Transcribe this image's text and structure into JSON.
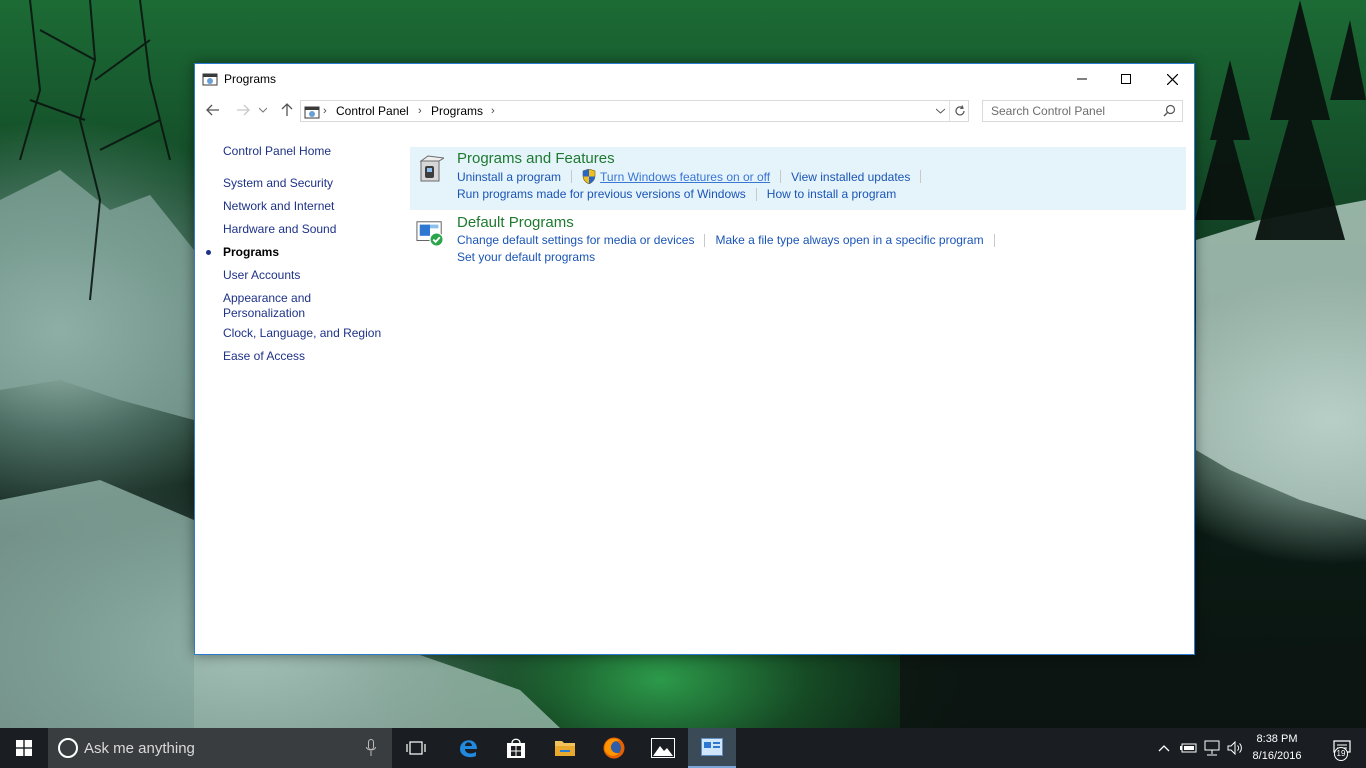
{
  "window": {
    "title": "Programs",
    "controls": {
      "minimize": "minimize",
      "maximize": "maximize",
      "close": "close"
    }
  },
  "address_bar": {
    "breadcrumbs": [
      "Control Panel",
      "Programs"
    ],
    "search_placeholder": "Search Control Panel"
  },
  "left_pane": {
    "home": "Control Panel Home",
    "items": [
      {
        "label": "System and Security",
        "current": false
      },
      {
        "label": "Network and Internet",
        "current": false
      },
      {
        "label": "Hardware and Sound",
        "current": false
      },
      {
        "label": "Programs",
        "current": true
      },
      {
        "label": "User Accounts",
        "current": false
      },
      {
        "label": "Appearance and Personalization",
        "current": false
      },
      {
        "label": "Clock, Language, and Region",
        "current": false
      },
      {
        "label": "Ease of Access",
        "current": false
      }
    ]
  },
  "sections": [
    {
      "title": "Programs and Features",
      "links": [
        "Uninstall a program",
        "Turn Windows features on or off",
        "View installed updates",
        "Run programs made for previous versions of Windows",
        "How to install a program"
      ]
    },
    {
      "title": "Default Programs",
      "links": [
        "Change default settings for media or devices",
        "Make a file type always open in a specific program",
        "Set your default programs"
      ]
    }
  ],
  "taskbar": {
    "search_text": "Ask me anything",
    "pinned_apps": [
      "task-view",
      "edge",
      "store",
      "file-explorer",
      "firefox",
      "photos",
      "control-panel"
    ],
    "active_app": "control-panel",
    "clock_time": "8:38 PM",
    "clock_date": "8/16/2016",
    "notification_count": "19"
  },
  "colors": {
    "link": "#1a55b6",
    "section_title": "#1e7a30",
    "highlight": "#e5f3fb",
    "taskbar": "#1a1e22"
  }
}
